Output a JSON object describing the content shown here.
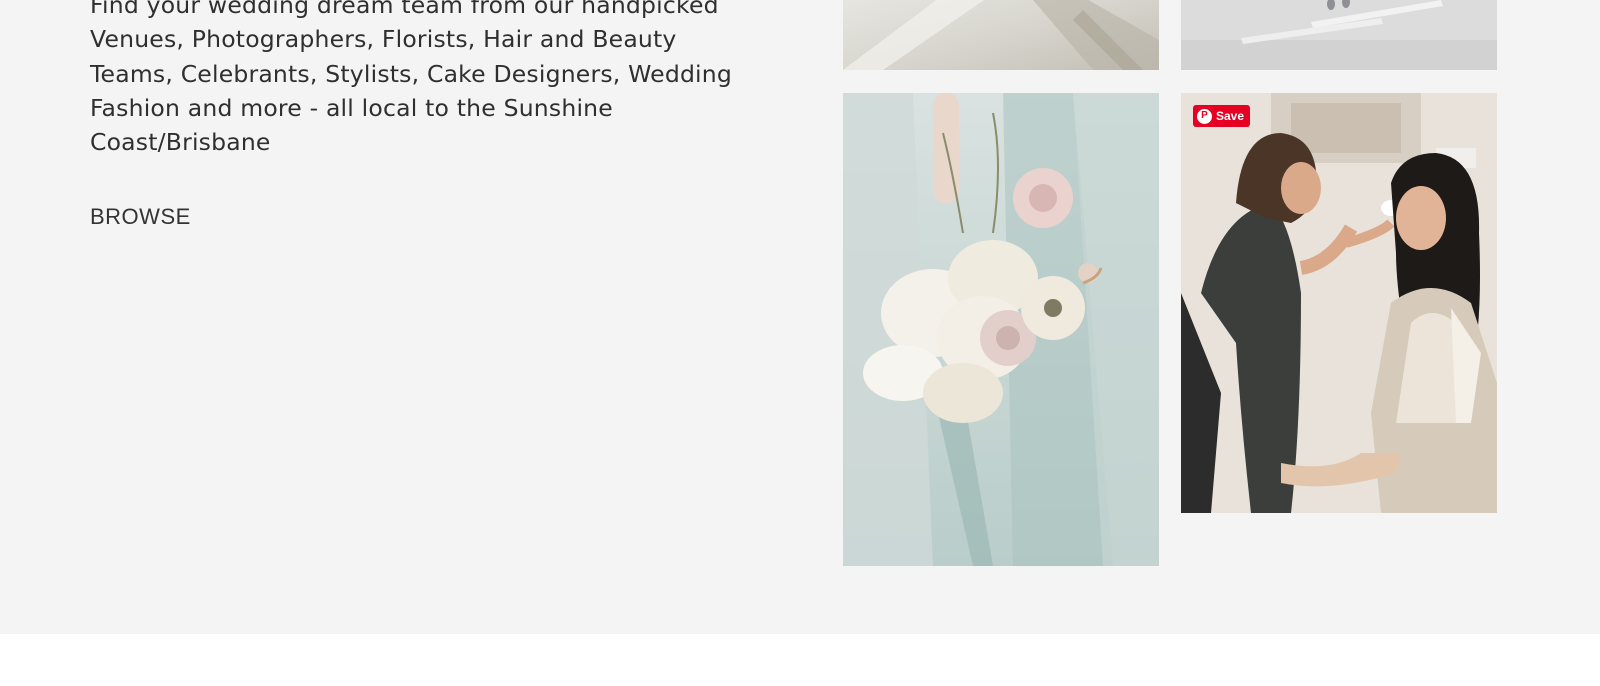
{
  "intro": {
    "text": "Find your wedding dream team from our handpicked Venues, Photographers, Florists, Hair and Beauty Teams, Celebrants, Stylists, Cake Designers, Wedding Fashion and more - all local to the Sunshine Coast/Brisbane"
  },
  "browse": {
    "label": "BROWSE"
  },
  "gallery": {
    "save_label": "Save",
    "save_icon": "pinterest-icon",
    "photos": [
      {
        "name": "veil-detail-photo"
      },
      {
        "name": "table-cutlery-photo"
      },
      {
        "name": "bridal-bouquet-photo"
      },
      {
        "name": "bride-makeup-photo"
      }
    ]
  },
  "colors": {
    "section_bg": "#f4f4f4",
    "text": "#2f2f2f",
    "pinterest_red": "#e60023"
  }
}
